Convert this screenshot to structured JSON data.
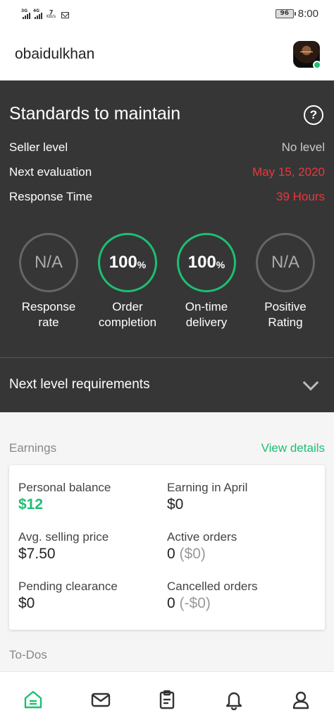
{
  "status_bar": {
    "signal1_label": "3G",
    "signal2_label": "4G",
    "speed_value": "7",
    "speed_unit": "KB/s",
    "battery": "96",
    "time": "8:00"
  },
  "header": {
    "username": "obaidulkhan"
  },
  "standards": {
    "title": "Standards to maintain",
    "help_symbol": "?",
    "rows": [
      {
        "label": "Seller level",
        "value": "No level"
      },
      {
        "label": "Next evaluation",
        "value": "May 15, 2020"
      },
      {
        "label": "Response Time",
        "value": "39 Hours"
      }
    ],
    "metrics": [
      {
        "value": "N/A",
        "percent": "",
        "label_line1": "Response",
        "label_line2": "rate"
      },
      {
        "value": "100",
        "percent": "%",
        "label_line1": "Order",
        "label_line2": "completion"
      },
      {
        "value": "100",
        "percent": "%",
        "label_line1": "On-time",
        "label_line2": "delivery"
      },
      {
        "value": "N/A",
        "percent": "",
        "label_line1": "Positive",
        "label_line2": "Rating"
      }
    ],
    "next_level": "Next level requirements",
    "colors": {
      "green": "#1dbf73",
      "red": "#e8383d",
      "dark_bg": "#363636"
    }
  },
  "earnings": {
    "label": "Earnings",
    "view_details": "View details",
    "items": [
      {
        "title": "Personal balance",
        "value": "$12",
        "extra": ""
      },
      {
        "title": "Earning in April",
        "value": "$0",
        "extra": ""
      },
      {
        "title": "Avg. selling price",
        "value": "$7.50",
        "extra": ""
      },
      {
        "title": "Active orders",
        "value": "0",
        "extra": "($0)"
      },
      {
        "title": "Pending clearance",
        "value": "$0",
        "extra": ""
      },
      {
        "title": "Cancelled orders",
        "value": "0",
        "extra": "(-$0)"
      }
    ]
  },
  "todos": {
    "label": "To-Dos"
  },
  "bottom_nav": {
    "items": [
      "home-icon",
      "messages-icon",
      "orders-icon",
      "notifications-icon",
      "profile-icon"
    ]
  }
}
